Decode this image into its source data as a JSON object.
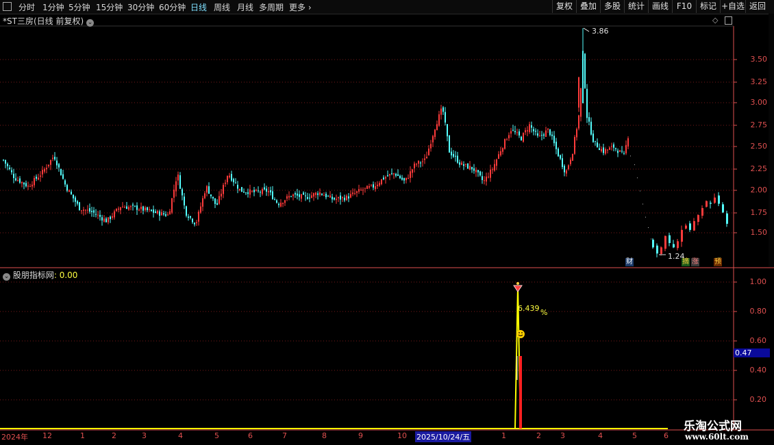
{
  "toolbar": {
    "periods": [
      "分时",
      "1分钟",
      "5分钟",
      "15分钟",
      "30分钟",
      "60分钟",
      "日线",
      "周线",
      "月线",
      "多周期",
      "更多"
    ],
    "active_period": "日线",
    "right_buttons": [
      "复权",
      "叠加",
      "多股",
      "统计",
      "画线",
      "F10",
      "标记",
      "+自选",
      "返回"
    ]
  },
  "main_panel": {
    "title": "*ST三房(日线 前复权)",
    "high_label": "3.86",
    "low_label": "1.24",
    "y_ticks": [
      "3.50",
      "3.25",
      "3.00",
      "2.75",
      "2.50",
      "2.25",
      "2.00",
      "1.75",
      "1.50"
    ],
    "badges": [
      "财",
      "摘",
      "涨",
      "预"
    ]
  },
  "indicator_panel": {
    "title": "股朋指标网",
    "value_text": ": 0.00",
    "pct_label": "6.439",
    "pct_unit": "%",
    "current_value": "0.47",
    "y_ticks": [
      "1.00",
      "0.80",
      "0.60",
      "0.40",
      "0.20"
    ]
  },
  "date_axis": {
    "labels": [
      "2024年",
      "12",
      "1",
      "2",
      "3",
      "4",
      "5",
      "6",
      "7",
      "8",
      "9",
      "10",
      "1",
      "2",
      "3",
      "4",
      "5",
      "6"
    ],
    "cursor_date": "2025/10/24/五"
  },
  "watermark": {
    "line1": "乐淘公式网",
    "line2": "www.60lt.com"
  },
  "colors": {
    "up": "#ff3b3b",
    "down": "#54ffff",
    "axis": "#e05050",
    "signal": "#ffff00"
  }
}
